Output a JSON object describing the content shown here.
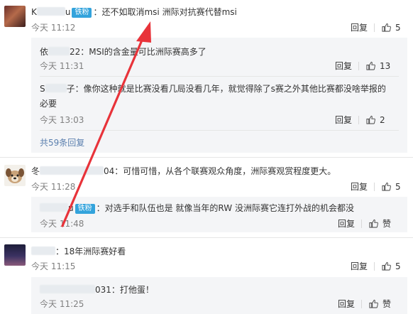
{
  "comments": [
    {
      "name_prefix": "K",
      "name_suffix": "u",
      "badge": "铁粉",
      "text": "：还不如取消msi 洲际对抗赛代替msi",
      "time": "今天 11:12",
      "reply": "回复",
      "likes": "5",
      "subs": [
        {
          "name_prefix": "依",
          "name_suffix": "22",
          "text": "：MSI的含金量可比洲际赛高多了",
          "time": "今天 11:31",
          "reply": "回复",
          "likes": "13"
        },
        {
          "name_prefix": "S",
          "name_suffix": "子",
          "text_line1": "：像你这种就是比赛没看几局没看几年，就觉得除了s赛之外其他比赛都没啥举报的",
          "text_line2": "必要",
          "time": "今天 13:03",
          "reply": "回复",
          "likes": "2"
        }
      ],
      "more": "共59条回复"
    },
    {
      "name_prefix": "冬",
      "name_suffix": "04",
      "text": "：可惜可惜，从各个联赛观众角度，洲际赛观赏程度更大。",
      "time": "今天 11:28",
      "reply": "回复",
      "likes": "5",
      "subs": [
        {
          "name_prefix": "",
          "name_suffix": "u",
          "badge": "铁粉",
          "text": "：对选手和队伍也是 就像当年的RW 没洲际赛它连打外战的机会都没",
          "time": "今天 11:48",
          "reply": "回复",
          "likes": "赞"
        }
      ]
    },
    {
      "name_prefix": "",
      "name_suffix": "",
      "text": "：18年洲际赛好看",
      "time": "今天 11:15",
      "reply": "回复",
      "likes": "5",
      "subs": [
        {
          "name_prefix": "",
          "name_suffix": "031",
          "text": "：打他蛋！",
          "time": "今天 11:25",
          "reply": "回复",
          "likes": "赞"
        }
      ]
    }
  ],
  "colors": {
    "arrow": "#e8333a",
    "link": "#5a7fae",
    "badge": "#33a3dc"
  }
}
